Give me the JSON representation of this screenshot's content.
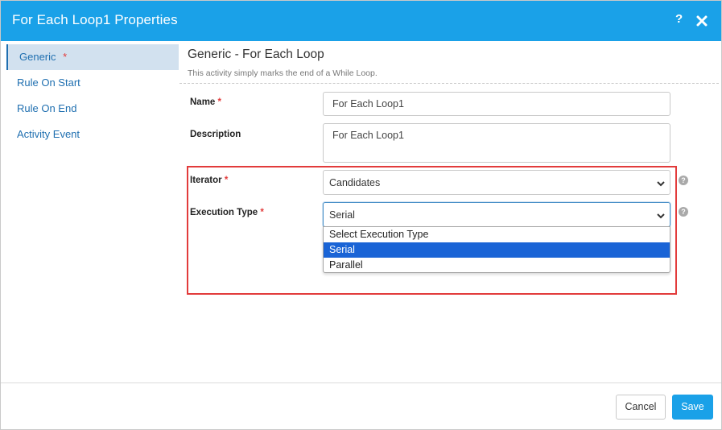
{
  "dialog": {
    "title": "For Each Loop1 Properties",
    "help_glyph": "?",
    "accent_color": "#1aa1e8"
  },
  "sidebar": {
    "items": [
      {
        "label": "Generic",
        "required": "*",
        "active": true
      },
      {
        "label": "Rule On Start"
      },
      {
        "label": "Rule On End"
      },
      {
        "label": "Activity Event"
      }
    ]
  },
  "section": {
    "title": "Generic - For Each Loop",
    "description": "This activity simply marks the end of a While Loop."
  },
  "form": {
    "required_mark": "*",
    "name": {
      "label": "Name",
      "value": "For Each Loop1"
    },
    "description": {
      "label": "Description",
      "value": "For Each Loop1"
    },
    "iterator": {
      "label": "Iterator",
      "value": "Candidates"
    },
    "execution_type": {
      "label": "Execution Type",
      "value": "Serial",
      "options": [
        "Select Execution Type",
        "Serial",
        "Parallel"
      ],
      "selected_index": 1
    },
    "help_glyph": "?"
  },
  "footer": {
    "cancel_label": "Cancel",
    "save_label": "Save"
  }
}
